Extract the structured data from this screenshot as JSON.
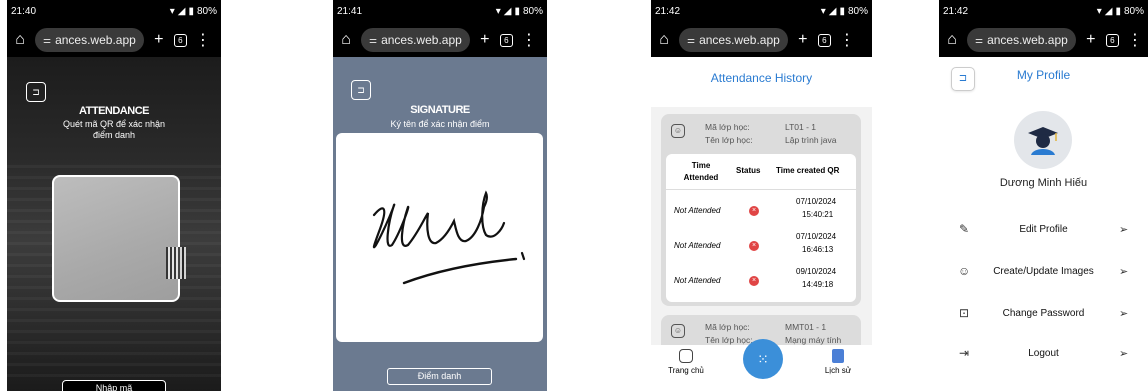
{
  "colors": {
    "accent": "#2a7bd1",
    "fab": "#3b8fd9",
    "signature_bg": "#6b7a90",
    "status_error": "#e04545"
  },
  "screen1": {
    "status": {
      "time": "21:40",
      "battery": "80%"
    },
    "browser": {
      "url": "ances.web.app",
      "tab_count": "6"
    },
    "title": "ATTENDANCE",
    "subtitle_line1": "Quét mã QR để xác nhận",
    "subtitle_line2": "điểm danh",
    "scan_button": "Nhập mã"
  },
  "screen2": {
    "status": {
      "time": "21:41",
      "battery": "80%"
    },
    "browser": {
      "url": "ances.web.app",
      "tab_count": "6"
    },
    "title": "SIGNATURE",
    "subtitle": "Ký tên để xác nhận điểm",
    "submit_button": "Điểm danh"
  },
  "screen3": {
    "status": {
      "time": "21:42",
      "battery": "80%"
    },
    "browser": {
      "url": "ances.web.app",
      "tab_count": "6"
    },
    "page_title": "Attendance History",
    "card1": {
      "class_code_label": "Mã lớp học:",
      "class_code": "LT01 - 1",
      "class_name_label": "Tên lớp học:",
      "class_name": "Lập trình java"
    },
    "table": {
      "headers": {
        "time": "Time Attended",
        "status": "Status",
        "created": "Time created QR"
      },
      "rows": [
        {
          "time": "Not Attended",
          "created_date": "07/10/2024",
          "created_time": "15:40:21"
        },
        {
          "time": "Not Attended",
          "created_date": "07/10/2024",
          "created_time": "16:46:13"
        },
        {
          "time": "Not Attended",
          "created_date": "09/10/2024",
          "created_time": "14:49:18"
        }
      ]
    },
    "card2": {
      "class_code_label": "Mã lớp học:",
      "class_code": "MMT01 - 1",
      "class_name_label": "Tên lớp học:",
      "class_name": "Mạng máy tính"
    },
    "nav": {
      "home": "Trang chủ",
      "history": "Lịch sử"
    }
  },
  "screen4": {
    "status": {
      "time": "21:42",
      "battery": "80%"
    },
    "browser": {
      "url": "ances.web.app",
      "tab_count": "6"
    },
    "page_title": "My Profile",
    "user_name": "Dương Minh Hiếu",
    "menu": [
      {
        "label": "Edit Profile",
        "icon": "pencil-icon"
      },
      {
        "label": "Create/Update Images",
        "icon": "face-scan-icon"
      },
      {
        "label": "Change Password",
        "icon": "lock-icon"
      },
      {
        "label": "Logout",
        "icon": "logout-icon"
      }
    ]
  }
}
